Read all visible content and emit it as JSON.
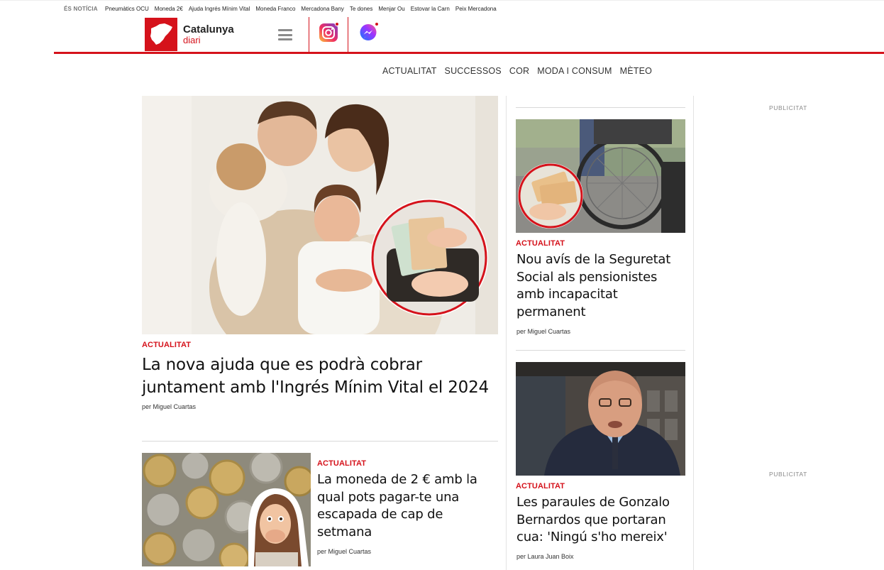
{
  "trending": {
    "label": "ÉS NOTÍCIA",
    "items": [
      "Pneumàtics OCU",
      "Moneda 2€",
      "Ajuda Ingrés Mínim Vital",
      "Moneda Franco",
      "Mercadona Bany",
      "Te dones",
      "Menjar Ou",
      "Estovar la Carn",
      "Peix Mercadona"
    ]
  },
  "brand": {
    "line1": "Catalunya",
    "line2": "diari",
    "color": "#d5121b"
  },
  "nav": {
    "items": [
      "ACTUALITAT",
      "SUCCESSOS",
      "COR",
      "MODA I CONSUM",
      "MÈTEO"
    ]
  },
  "hero": {
    "category": "ACTUALITAT",
    "title": "La nova ajuda que es podrà cobrar juntament amb l'Ingrés Mínim Vital el 2024",
    "byline": "per Miguel Cuartas"
  },
  "secondary": {
    "category": "ACTUALITAT",
    "title": "La moneda de 2 € amb la qual pots pagar-te una escapada de cap de setmana",
    "byline": "per Miguel Cuartas"
  },
  "side": [
    {
      "category": "ACTUALITAT",
      "title": "Nou avís de la Seguretat Social als pensionistes amb incapacitat permanent",
      "byline": "per Miguel Cuartas"
    },
    {
      "category": "ACTUALITAT",
      "title": "Les paraules de Gonzalo Bernardos que portaran cua: 'Ningú s'ho mereix'",
      "byline": "per Laura Juan Boix"
    }
  ],
  "ads": {
    "label": "PUBLICITAT"
  }
}
